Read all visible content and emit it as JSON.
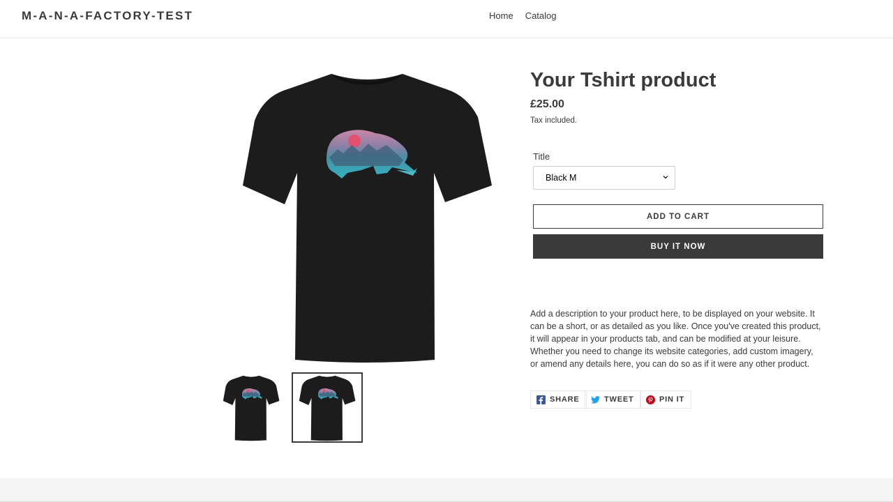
{
  "header": {
    "logo": "M-A-N-A-FACTORY-TEST",
    "nav": [
      {
        "label": "Home"
      },
      {
        "label": "Catalog"
      }
    ]
  },
  "product": {
    "title": "Your Tshirt product",
    "price": "£25.00",
    "tax_note": "Tax included.",
    "option_label": "Title",
    "option_selected": "Black M",
    "add_to_cart": "ADD TO CART",
    "buy_now": "BUY IT NOW",
    "description": "Add a description to your product here, to be displayed on your website. It can be a short, or as detailed as you like. Once you've created this product, it will appear in your products tab, and can be modified at your leisure. Whether you need to change its website categories, add custom imagery, or amend any details here, you can do so as if it were any other product."
  },
  "share": {
    "facebook": "SHARE",
    "twitter": "TWEET",
    "pinterest": "PIN IT"
  },
  "colors": {
    "text": "#3a3a3a",
    "button_dark": "#3a3a3a",
    "shirt": "#1c1c1c",
    "facebook": "#3b5998",
    "twitter": "#1da1f2",
    "pinterest": "#bd081c"
  },
  "icons": [
    "chevron-down-icon",
    "facebook-icon",
    "twitter-icon",
    "pinterest-icon"
  ]
}
